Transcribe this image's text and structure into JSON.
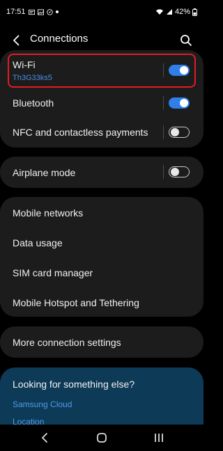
{
  "status": {
    "time": "17:51",
    "battery": "42%"
  },
  "header": {
    "title": "Connections"
  },
  "groups": {
    "wireless": [
      {
        "label": "Wi-Fi",
        "sub": "Th3G33ks5",
        "toggle": true
      },
      {
        "label": "Bluetooth",
        "toggle": true
      },
      {
        "label": "NFC and contactless payments",
        "toggle": false
      }
    ],
    "airplane": {
      "label": "Airplane mode",
      "toggle": false
    },
    "networks": [
      {
        "label": "Mobile networks"
      },
      {
        "label": "Data usage"
      },
      {
        "label": "SIM card manager"
      },
      {
        "label": "Mobile Hotspot and Tethering"
      }
    ],
    "more": {
      "label": "More connection settings"
    }
  },
  "suggestions": {
    "title": "Looking for something else?",
    "links": [
      "Samsung Cloud",
      "Location"
    ]
  },
  "colors": {
    "accent": "#2f7fe6",
    "highlight": "#e21b24",
    "card_bg": "#1c1c1c",
    "suggest_bg": "#0d3a57"
  }
}
